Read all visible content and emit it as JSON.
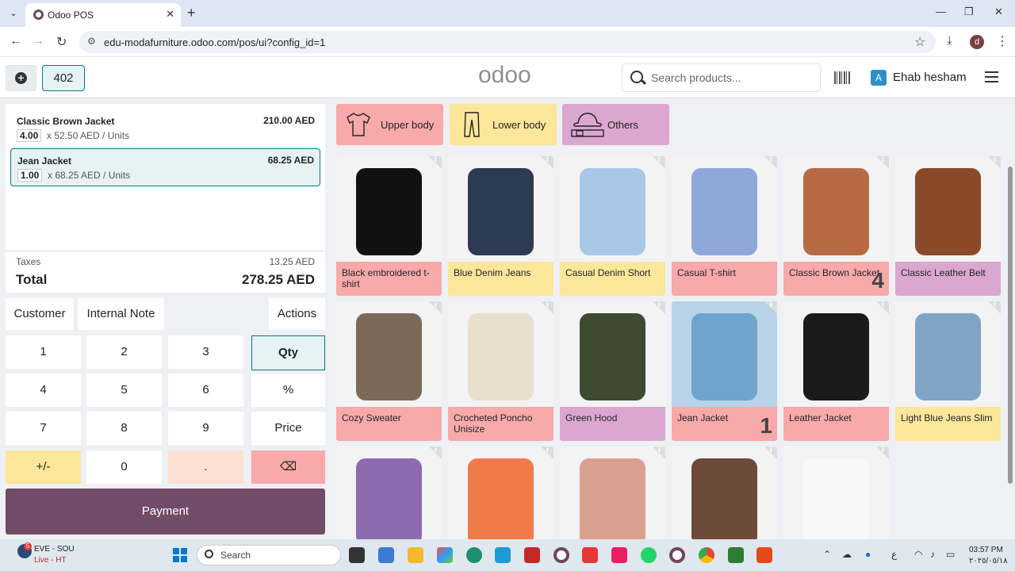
{
  "browser": {
    "tab_title": "Odoo POS",
    "url": "edu-modafurniture.odoo.com/pos/ui?config_id=1",
    "profile_initial": "d"
  },
  "header": {
    "order_number": "402",
    "logo": "odoo",
    "search_placeholder": "Search products...",
    "user_initial": "A",
    "user_name": "Ehab hesham"
  },
  "order": {
    "lines": [
      {
        "name": "Classic Brown Jacket",
        "price": "210.00 AED",
        "qty": "4.00",
        "unit": "x 52.50 AED / Units",
        "selected": false
      },
      {
        "name": "Jean Jacket",
        "price": "68.25 AED",
        "qty": "1.00",
        "unit": "x 68.25 AED / Units",
        "selected": true
      }
    ],
    "taxes_label": "Taxes",
    "taxes_value": "13.25 AED",
    "total_label": "Total",
    "total_value": "278.25 AED"
  },
  "controls": {
    "customer": "Customer",
    "internal_note": "Internal Note",
    "actions": "Actions"
  },
  "numpad": {
    "keys": [
      "1",
      "2",
      "3",
      "Qty",
      "4",
      "5",
      "6",
      "%",
      "7",
      "8",
      "9",
      "Price",
      "+/-",
      "0",
      ".",
      "⌫"
    ],
    "payment": "Payment"
  },
  "categories": [
    {
      "label": "Upper body",
      "color": "#f8a9a9"
    },
    {
      "label": "Lower body",
      "color": "#fbe69a"
    },
    {
      "label": "Others",
      "color": "#dba7d0"
    }
  ],
  "products": [
    {
      "name": "Black embroidered t-shirt",
      "color": "#f8a9a9",
      "qty": ""
    },
    {
      "name": "Blue Denim Jeans",
      "color": "#fbe69a",
      "qty": ""
    },
    {
      "name": "Casual Denim Short",
      "color": "#fbe69a",
      "qty": ""
    },
    {
      "name": "Casual T-shirt",
      "color": "#f8a9a9",
      "qty": ""
    },
    {
      "name": "Classic Brown Jacket",
      "color": "#f8a9a9",
      "qty": "4"
    },
    {
      "name": "Classic Leather Belt",
      "color": "#dba7d0",
      "qty": ""
    },
    {
      "name": "Cozy Sweater",
      "color": "#f8a9a9",
      "qty": ""
    },
    {
      "name": "Crocheted Poncho Unisize",
      "color": "#f8a9a9",
      "qty": ""
    },
    {
      "name": "Green Hood",
      "color": "#dba7d0",
      "qty": ""
    },
    {
      "name": "Jean Jacket",
      "color": "#f8a9a9",
      "qty": "1"
    },
    {
      "name": "Leather Jacket",
      "color": "#f8a9a9",
      "qty": ""
    },
    {
      "name": "Light Blue Jeans Slim",
      "color": "#fbe69a",
      "qty": ""
    },
    {
      "name": "",
      "color": "#f8a9a9",
      "qty": ""
    },
    {
      "name": "",
      "color": "#f8a9a9",
      "qty": ""
    },
    {
      "name": "",
      "color": "#dba7d0",
      "qty": ""
    },
    {
      "name": "",
      "color": "#f8a9a9",
      "qty": ""
    },
    {
      "name": "",
      "color": "#f8a9a9",
      "qty": ""
    }
  ],
  "taskbar": {
    "weather_line1": "EVE - SOU",
    "weather_line2": "Live - HT",
    "weather_badge": "5",
    "search": "Search",
    "time": "03:57 PM",
    "date": "٢٠٢٥/٠٥/١٨",
    "lang": "ع"
  }
}
